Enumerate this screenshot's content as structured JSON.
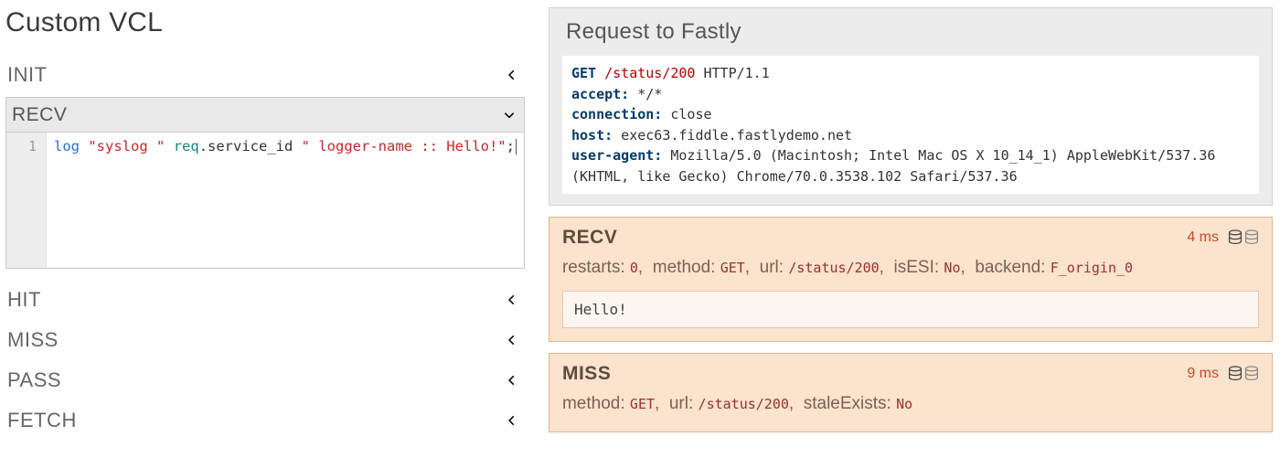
{
  "page_title": "Custom VCL",
  "sections": {
    "init": {
      "label": "INIT",
      "expanded": false
    },
    "recv": {
      "label": "RECV",
      "expanded": true
    },
    "hit": {
      "label": "HIT",
      "expanded": false
    },
    "miss": {
      "label": "MISS",
      "expanded": false
    },
    "pass": {
      "label": "PASS",
      "expanded": false
    },
    "fetch": {
      "label": "FETCH",
      "expanded": false
    }
  },
  "editor": {
    "gutter": [
      "1"
    ],
    "code_tokens": [
      {
        "cls": "tk-key",
        "t": "log"
      },
      {
        "cls": "",
        "t": " "
      },
      {
        "cls": "tk-str",
        "t": "\"syslog \""
      },
      {
        "cls": "",
        "t": " "
      },
      {
        "cls": "tk-sp",
        "t": "req"
      },
      {
        "cls": "",
        "t": ".service_id "
      },
      {
        "cls": "tk-str",
        "t": "\" logger-name :: Hello!\""
      },
      {
        "cls": "",
        "t": ";"
      }
    ]
  },
  "request_panel": {
    "title": "Request to Fastly",
    "request_line": {
      "method": "GET",
      "path": "/status/200",
      "proto": "HTTP/1.1"
    },
    "headers": [
      {
        "k": "accept",
        "v": "*/*"
      },
      {
        "k": "connection",
        "v": "close"
      },
      {
        "k": "host",
        "v": "exec63.fiddle.fastlydemo.net"
      },
      {
        "k": "user-agent",
        "v": "Mozilla/5.0 (Macintosh; Intel Mac OS X 10_14_1) AppleWebKit/537.36 (KHTML, like Gecko) Chrome/70.0.3538.102 Safari/537.36"
      }
    ]
  },
  "phases": [
    {
      "id": "recv",
      "title": "RECV",
      "time": "4 ms",
      "props": [
        {
          "k": "restarts",
          "v": "0"
        },
        {
          "k": "method",
          "v": "GET"
        },
        {
          "k": "url",
          "v": "/status/200"
        },
        {
          "k": "isESI",
          "v": "No"
        },
        {
          "k": "backend",
          "v": "F_origin_0"
        }
      ],
      "log": "Hello!"
    },
    {
      "id": "miss",
      "title": "MISS",
      "time": "9 ms",
      "props": [
        {
          "k": "method",
          "v": "GET"
        },
        {
          "k": "url",
          "v": "/status/200"
        },
        {
          "k": "staleExists",
          "v": "No"
        }
      ],
      "log": null
    }
  ]
}
